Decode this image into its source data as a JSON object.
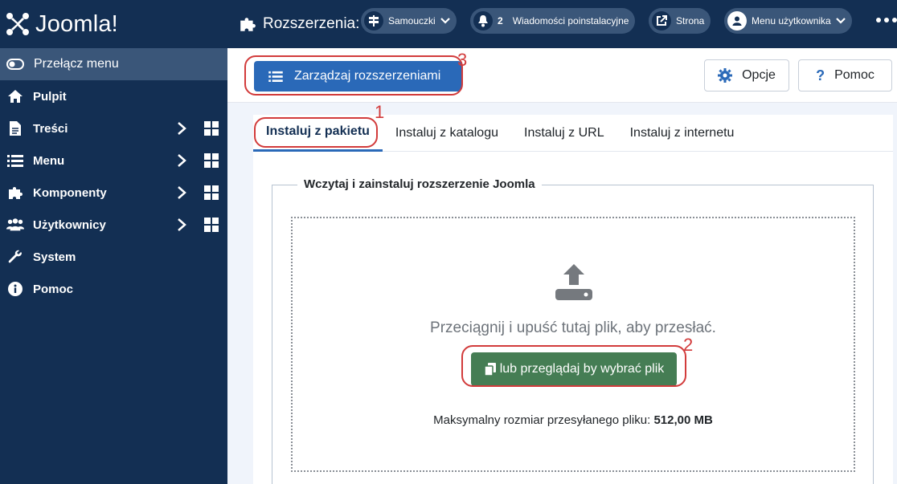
{
  "brand": {
    "logo_text": "Joomla!"
  },
  "sidebar": {
    "toggle_label": "Przełącz menu",
    "items": [
      {
        "label": "Pulpit",
        "icon": "home-icon"
      },
      {
        "label": "Treści",
        "icon": "file-icon"
      },
      {
        "label": "Menu",
        "icon": "list-icon"
      },
      {
        "label": "Komponenty",
        "icon": "puzzle-icon"
      },
      {
        "label": "Użytkownicy",
        "icon": "users-icon"
      },
      {
        "label": "System",
        "icon": "wrench-icon"
      },
      {
        "label": "Pomoc",
        "icon": "info-icon"
      }
    ]
  },
  "header": {
    "title": "Rozszerzenia:",
    "tutorials_label": "Samouczki",
    "postinstall_count": "2",
    "postinstall_label": "Wiadomości poinstalacyjne",
    "site_label": "Strona",
    "user_menu_label": "Menu użytkownika"
  },
  "toolbar": {
    "manage_label": "Zarządzaj rozszerzeniami",
    "options_label": "Opcje",
    "help_label": "Pomoc"
  },
  "tabs": [
    {
      "label": "Instaluj z pakietu",
      "active": true
    },
    {
      "label": "Instaluj z katalogu"
    },
    {
      "label": "Instaluj z URL"
    },
    {
      "label": "Instaluj z internetu"
    }
  ],
  "upload": {
    "legend": "Wczytaj i zainstaluj rozszerzenie Joomla",
    "drop_text": "Przeciągnij i upuść tutaj plik, aby przesłać.",
    "browse_label": "lub przeglądaj by wybrać plik",
    "max_size_label": "Maksymalny rozmiar przesyłanego pliku:",
    "max_size_value": "512,00 MB"
  },
  "annotations": {
    "one": "1",
    "two": "2",
    "three": "3"
  },
  "colors": {
    "sidebar": "#132f53",
    "primary": "#2a69b8",
    "success": "#457d54",
    "annotation": "#d23b3b"
  }
}
